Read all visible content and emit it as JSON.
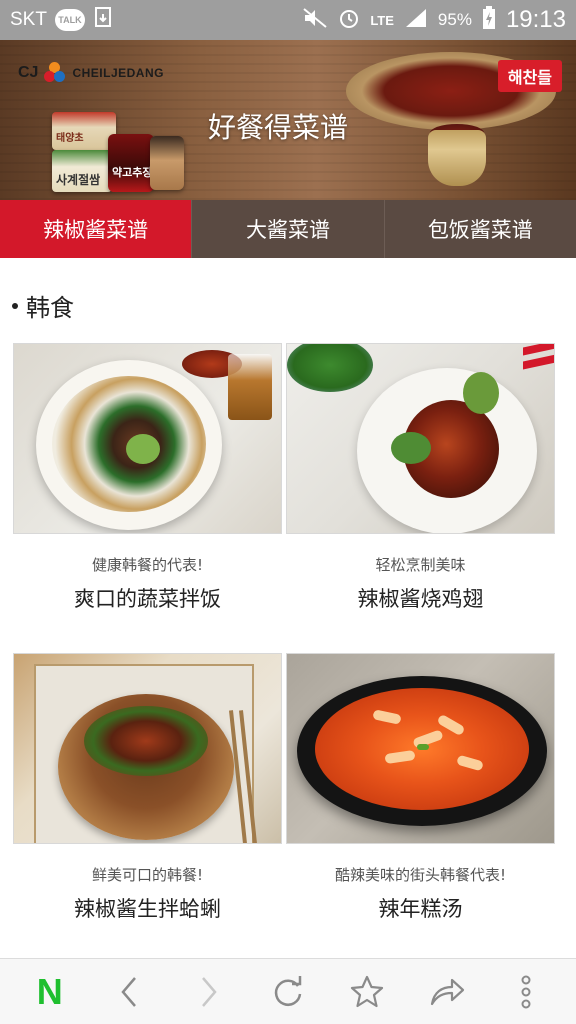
{
  "status_bar": {
    "carrier": "SKT",
    "talk_badge": "TALK",
    "network": "LTE",
    "battery": "95%",
    "time": "19:13"
  },
  "banner": {
    "company": "CJ",
    "brand": "CHEILJEDANG",
    "title": "好餐得菜谱",
    "tag": "해찬들",
    "package_labels": [
      "사계절쌈",
      "태양초",
      "약고추장"
    ]
  },
  "tabs": [
    {
      "label": "辣椒酱菜谱",
      "active": true
    },
    {
      "label": "大酱菜谱",
      "active": false
    },
    {
      "label": "包饭酱菜谱",
      "active": false
    }
  ],
  "section": {
    "title": "韩食"
  },
  "recipes": [
    {
      "subtitle": "健康韩餐的代表!",
      "title": "爽口的蔬菜拌饭"
    },
    {
      "subtitle": "轻松烹制美味",
      "title": "辣椒酱烧鸡翅"
    },
    {
      "subtitle": "鲜美可口的韩餐!",
      "title": "辣椒酱生拌蛤蜊"
    },
    {
      "subtitle": "酷辣美味的街头韩餐代表!",
      "title": "辣年糕汤"
    }
  ],
  "bottom_nav": {
    "home_logo": "N",
    "icons": [
      "naver-home-icon",
      "back-icon",
      "forward-icon",
      "refresh-icon",
      "bookmark-star-icon",
      "share-icon",
      "more-vertical-icon"
    ]
  },
  "colors": {
    "accent_red": "#d3182a",
    "tab_bg": "#5a4a42",
    "naver_green": "#1fbf2f",
    "status_bar_bg": "#9e9e9e"
  }
}
